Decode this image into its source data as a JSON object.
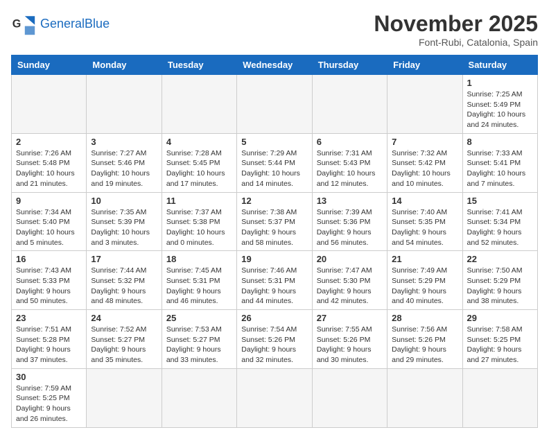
{
  "header": {
    "logo_general": "General",
    "logo_blue": "Blue",
    "month_title": "November 2025",
    "location": "Font-Rubi, Catalonia, Spain"
  },
  "weekdays": [
    "Sunday",
    "Monday",
    "Tuesday",
    "Wednesday",
    "Thursday",
    "Friday",
    "Saturday"
  ],
  "days": [
    {
      "num": "",
      "info": ""
    },
    {
      "num": "",
      "info": ""
    },
    {
      "num": "",
      "info": ""
    },
    {
      "num": "",
      "info": ""
    },
    {
      "num": "",
      "info": ""
    },
    {
      "num": "",
      "info": ""
    },
    {
      "num": "1",
      "info": "Sunrise: 7:25 AM\nSunset: 5:49 PM\nDaylight: 10 hours\nand 24 minutes."
    },
    {
      "num": "2",
      "info": "Sunrise: 7:26 AM\nSunset: 5:48 PM\nDaylight: 10 hours\nand 21 minutes."
    },
    {
      "num": "3",
      "info": "Sunrise: 7:27 AM\nSunset: 5:46 PM\nDaylight: 10 hours\nand 19 minutes."
    },
    {
      "num": "4",
      "info": "Sunrise: 7:28 AM\nSunset: 5:45 PM\nDaylight: 10 hours\nand 17 minutes."
    },
    {
      "num": "5",
      "info": "Sunrise: 7:29 AM\nSunset: 5:44 PM\nDaylight: 10 hours\nand 14 minutes."
    },
    {
      "num": "6",
      "info": "Sunrise: 7:31 AM\nSunset: 5:43 PM\nDaylight: 10 hours\nand 12 minutes."
    },
    {
      "num": "7",
      "info": "Sunrise: 7:32 AM\nSunset: 5:42 PM\nDaylight: 10 hours\nand 10 minutes."
    },
    {
      "num": "8",
      "info": "Sunrise: 7:33 AM\nSunset: 5:41 PM\nDaylight: 10 hours\nand 7 minutes."
    },
    {
      "num": "9",
      "info": "Sunrise: 7:34 AM\nSunset: 5:40 PM\nDaylight: 10 hours\nand 5 minutes."
    },
    {
      "num": "10",
      "info": "Sunrise: 7:35 AM\nSunset: 5:39 PM\nDaylight: 10 hours\nand 3 minutes."
    },
    {
      "num": "11",
      "info": "Sunrise: 7:37 AM\nSunset: 5:38 PM\nDaylight: 10 hours\nand 0 minutes."
    },
    {
      "num": "12",
      "info": "Sunrise: 7:38 AM\nSunset: 5:37 PM\nDaylight: 9 hours\nand 58 minutes."
    },
    {
      "num": "13",
      "info": "Sunrise: 7:39 AM\nSunset: 5:36 PM\nDaylight: 9 hours\nand 56 minutes."
    },
    {
      "num": "14",
      "info": "Sunrise: 7:40 AM\nSunset: 5:35 PM\nDaylight: 9 hours\nand 54 minutes."
    },
    {
      "num": "15",
      "info": "Sunrise: 7:41 AM\nSunset: 5:34 PM\nDaylight: 9 hours\nand 52 minutes."
    },
    {
      "num": "16",
      "info": "Sunrise: 7:43 AM\nSunset: 5:33 PM\nDaylight: 9 hours\nand 50 minutes."
    },
    {
      "num": "17",
      "info": "Sunrise: 7:44 AM\nSunset: 5:32 PM\nDaylight: 9 hours\nand 48 minutes."
    },
    {
      "num": "18",
      "info": "Sunrise: 7:45 AM\nSunset: 5:31 PM\nDaylight: 9 hours\nand 46 minutes."
    },
    {
      "num": "19",
      "info": "Sunrise: 7:46 AM\nSunset: 5:31 PM\nDaylight: 9 hours\nand 44 minutes."
    },
    {
      "num": "20",
      "info": "Sunrise: 7:47 AM\nSunset: 5:30 PM\nDaylight: 9 hours\nand 42 minutes."
    },
    {
      "num": "21",
      "info": "Sunrise: 7:49 AM\nSunset: 5:29 PM\nDaylight: 9 hours\nand 40 minutes."
    },
    {
      "num": "22",
      "info": "Sunrise: 7:50 AM\nSunset: 5:29 PM\nDaylight: 9 hours\nand 38 minutes."
    },
    {
      "num": "23",
      "info": "Sunrise: 7:51 AM\nSunset: 5:28 PM\nDaylight: 9 hours\nand 37 minutes."
    },
    {
      "num": "24",
      "info": "Sunrise: 7:52 AM\nSunset: 5:27 PM\nDaylight: 9 hours\nand 35 minutes."
    },
    {
      "num": "25",
      "info": "Sunrise: 7:53 AM\nSunset: 5:27 PM\nDaylight: 9 hours\nand 33 minutes."
    },
    {
      "num": "26",
      "info": "Sunrise: 7:54 AM\nSunset: 5:26 PM\nDaylight: 9 hours\nand 32 minutes."
    },
    {
      "num": "27",
      "info": "Sunrise: 7:55 AM\nSunset: 5:26 PM\nDaylight: 9 hours\nand 30 minutes."
    },
    {
      "num": "28",
      "info": "Sunrise: 7:56 AM\nSunset: 5:26 PM\nDaylight: 9 hours\nand 29 minutes."
    },
    {
      "num": "29",
      "info": "Sunrise: 7:58 AM\nSunset: 5:25 PM\nDaylight: 9 hours\nand 27 minutes."
    },
    {
      "num": "30",
      "info": "Sunrise: 7:59 AM\nSunset: 5:25 PM\nDaylight: 9 hours\nand 26 minutes."
    }
  ]
}
